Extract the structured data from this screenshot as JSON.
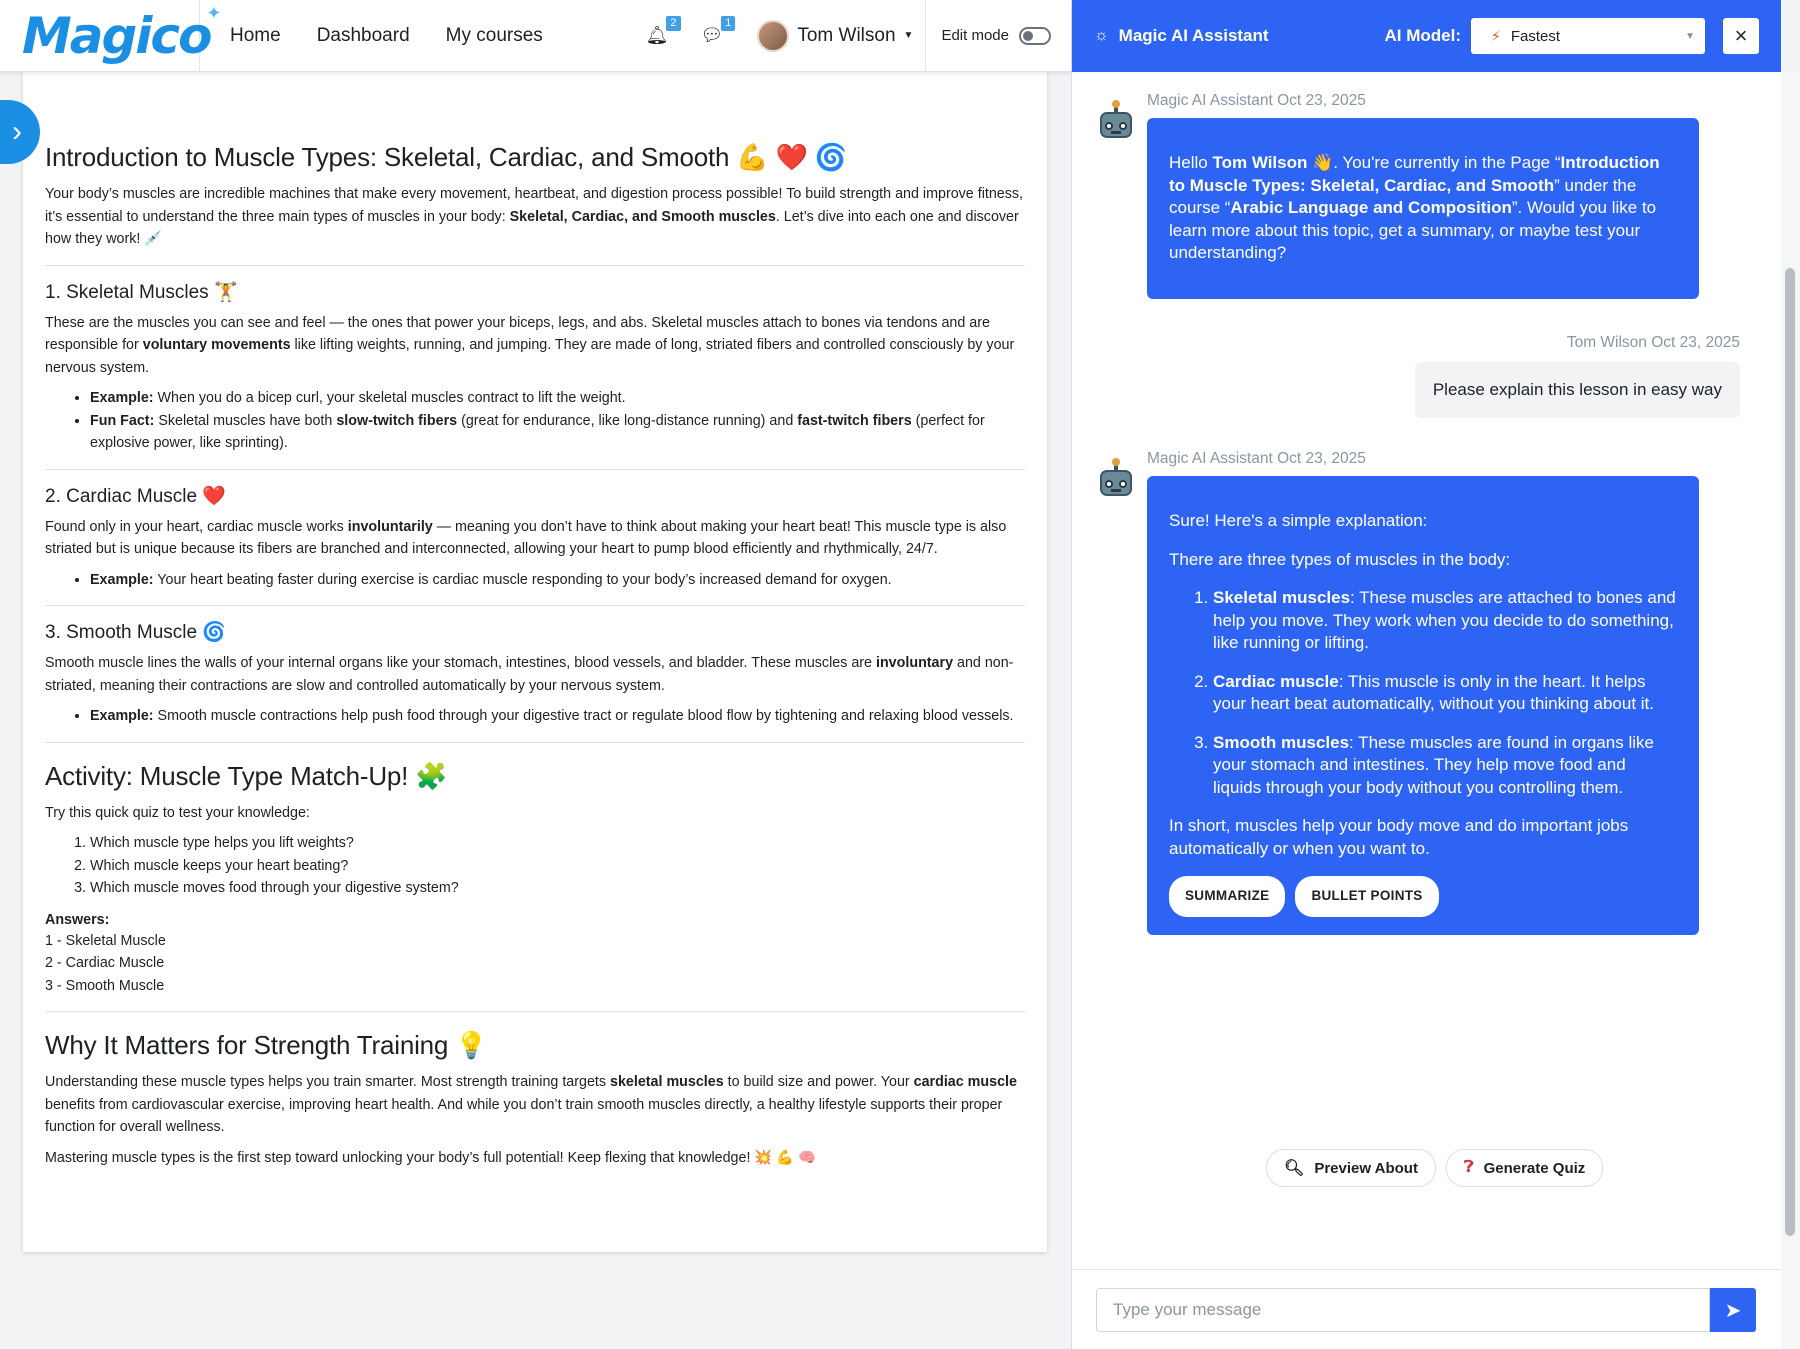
{
  "navbar": {
    "logo": "Magico",
    "links": [
      "Home",
      "Dashboard",
      "My courses"
    ],
    "notifications_count": "2",
    "messages_count": "1",
    "user_name": "Tom Wilson",
    "edit_mode_label": "Edit mode"
  },
  "lesson": {
    "title": "Introduction to Muscle Types: Skeletal, Cardiac, and Smooth 💪 ❤️ 🌀",
    "intro_1": "Your body’s muscles are incredible machines that make every movement, heartbeat, and digestion process possible! To build strength and improve fitness, it’s essential to understand the three main types of muscles in your body: ",
    "intro_bold": "Skeletal, Cardiac, and Smooth muscles",
    "intro_2": ". Let’s dive into each one and discover how they work! 💉",
    "skeletal": {
      "heading": "1. Skeletal Muscles 🏋",
      "p1": "These are the muscles you can see and feel — the ones that power your biceps, legs, and abs. Skeletal muscles attach to bones via tendons and are responsible for ",
      "p1_bold": "voluntary movements",
      "p1_end": " like lifting weights, running, and jumping. They are made of long, striated fibers and controlled consciously by your nervous system.",
      "ex_label": "Example:",
      "ex_text": " When you do a bicep curl, your skeletal muscles contract to lift the weight.",
      "fact_label": "Fun Fact:",
      "fact_1": " Skeletal muscles have both ",
      "fact_bold1": "slow-twitch fibers",
      "fact_2": " (great for endurance, like long-distance running) and ",
      "fact_bold2": "fast-twitch fibers",
      "fact_3": " (perfect for explosive power, like sprinting)."
    },
    "cardiac": {
      "heading": "2. Cardiac Muscle ❤️",
      "p1": "Found only in your heart, cardiac muscle works ",
      "p1_bold": "involuntarily",
      "p1_end": " — meaning you don’t have to think about making your heart beat! This muscle type is also striated but is unique because its fibers are branched and interconnected, allowing your heart to pump blood efficiently and rhythmically, 24/7.",
      "ex_label": "Example:",
      "ex_text": " Your heart beating faster during exercise is cardiac muscle responding to your body’s increased demand for oxygen."
    },
    "smooth": {
      "heading": "3. Smooth Muscle 🌀",
      "p1": "Smooth muscle lines the walls of your internal organs like your stomach, intestines, blood vessels, and bladder. These muscles are ",
      "p1_bold": "involuntary",
      "p1_end": " and non-striated, meaning their contractions are slow and controlled automatically by your nervous system.",
      "ex_label": "Example:",
      "ex_text": " Smooth muscle contractions help push food through your digestive tract or regulate blood flow by tightening and relaxing blood vessels."
    },
    "activity": {
      "heading": "Activity: Muscle Type Match-Up! 🧩",
      "intro": "Try this quick quiz to test your knowledge:",
      "questions": [
        "Which muscle type helps you lift weights?",
        "Which muscle keeps your heart beating?",
        "Which muscle moves food through your digestive system?"
      ],
      "answers_label": "Answers:",
      "answers": [
        "1 - Skeletal Muscle",
        "2 - Cardiac Muscle",
        "3 - Smooth Muscle"
      ]
    },
    "why": {
      "heading": "Why It Matters for Strength Training 💡",
      "p1_1": "Understanding these muscle types helps you train smarter. Most strength training targets ",
      "p1_bold1": "skeletal muscles",
      "p1_2": " to build size and power. Your ",
      "p1_bold2": "cardiac muscle",
      "p1_3": " benefits from cardiovascular exercise, improving heart health. And while you don’t train smooth muscles directly, a healthy lifestyle supports their proper function for overall wellness.",
      "p2": "Mastering muscle types is the first step toward unlocking your body’s full potential! Keep flexing that knowledge! 💥 💪 🧠"
    }
  },
  "assistant": {
    "title": "Magic AI Assistant",
    "model_label": "AI Model:",
    "model_value": "Fastest",
    "close": "×",
    "messages": [
      {
        "meta": "Magic AI Assistant Oct 23, 2025",
        "hello": "Hello ",
        "name": "Tom Wilson",
        "t1": " 👋. You're currently in the Page “",
        "page": "Introduction to Muscle Types: Skeletal, Cardiac, and Smooth",
        "t2": "” under the course “",
        "course": "Arabic Language and Composition",
        "t3": "”. Would you like to learn more about this topic, get a summary, or maybe test your understanding?"
      },
      {
        "meta": "Tom Wilson Oct 23, 2025",
        "text": "Please explain this lesson in easy way"
      },
      {
        "meta": "Magic AI Assistant Oct 23, 2025",
        "p1": "Sure! Here's a simple explanation:",
        "p2": "There are three types of muscles in the body:",
        "items": [
          {
            "bold": "Skeletal muscles",
            "text": ": These muscles are attached to bones and help you move. They work when you decide to do something, like running or lifting."
          },
          {
            "bold": "Cardiac muscle",
            "text": ": This muscle is only in the heart. It helps your heart beat automatically, without you thinking about it."
          },
          {
            "bold": "Smooth muscles",
            "text": ": These muscles are found in organs like your stomach and intestines. They help move food and liquids through your body without you controlling them."
          }
        ],
        "p3": "In short, muscles help your body move and do important jobs automatically or when you want to.",
        "btn_summarize": "SUMMARIZE",
        "btn_bullets": "BULLET POINTS"
      }
    ],
    "quick_preview": "Preview About",
    "quick_quiz": "Generate Quiz",
    "input_placeholder": "Type your message"
  }
}
